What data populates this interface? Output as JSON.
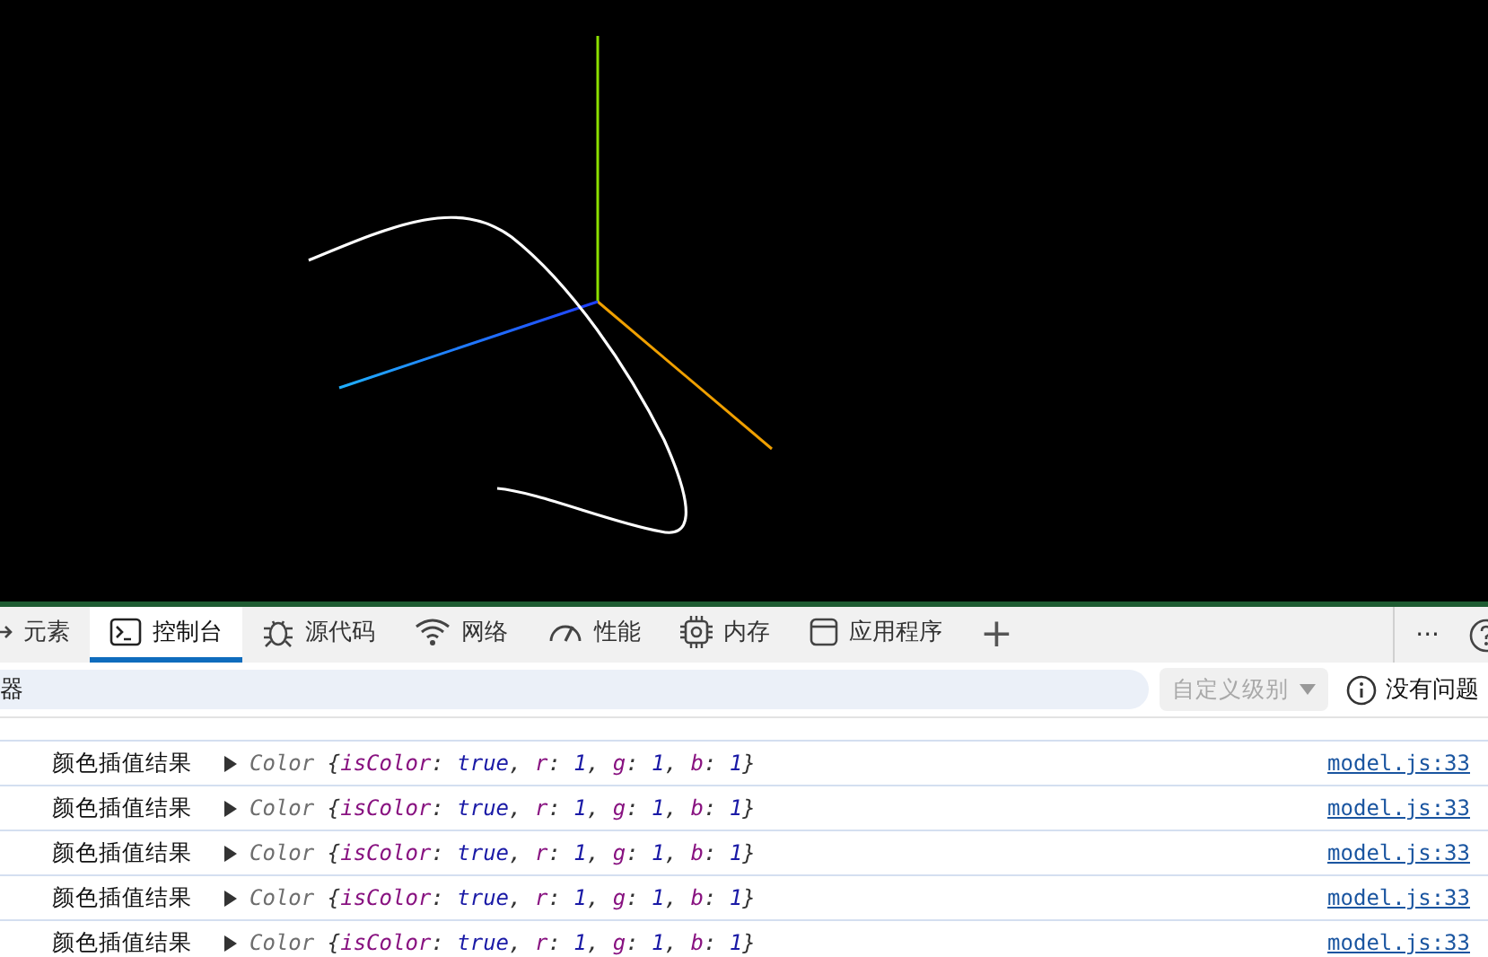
{
  "tabs": [
    {
      "label": "元素",
      "kind": "elements",
      "selected": false
    },
    {
      "label": "控制台",
      "kind": "console",
      "selected": true
    },
    {
      "label": "源代码",
      "kind": "sources",
      "selected": false
    },
    {
      "label": "网络",
      "kind": "network",
      "selected": false
    },
    {
      "label": "性能",
      "kind": "performance",
      "selected": false
    },
    {
      "label": "内存",
      "kind": "memory",
      "selected": false
    },
    {
      "label": "应用程序",
      "kind": "application",
      "selected": false
    }
  ],
  "add_tab": "+",
  "more_button": "···",
  "filter": {
    "value": "器"
  },
  "level_dropdown": {
    "label": "自定义级别",
    "disabled": true
  },
  "issues": "没有问题",
  "messages": [
    {
      "label": "颜色插值结果",
      "preview": "Color {isColor: true, r: 1, g: 1, b: 1}",
      "source": "model.js:33"
    },
    {
      "label": "颜色插值结果",
      "preview": "Color {isColor: true, r: 1, g: 1, b: 1}",
      "source": "model.js:33"
    },
    {
      "label": "颜色插值结果",
      "preview": "Color {isColor: true, r: 1, g: 1, b: 1}",
      "source": "model.js:33"
    },
    {
      "label": "颜色插值结果",
      "preview": "Color {isColor: true, r: 1, g: 1, b: 1}",
      "source": "model.js:33"
    },
    {
      "label": "颜色插值结果",
      "preview": "Color {isColor: true, r: 1, g: 1, b: 1}",
      "source": "model.js:33"
    }
  ]
}
